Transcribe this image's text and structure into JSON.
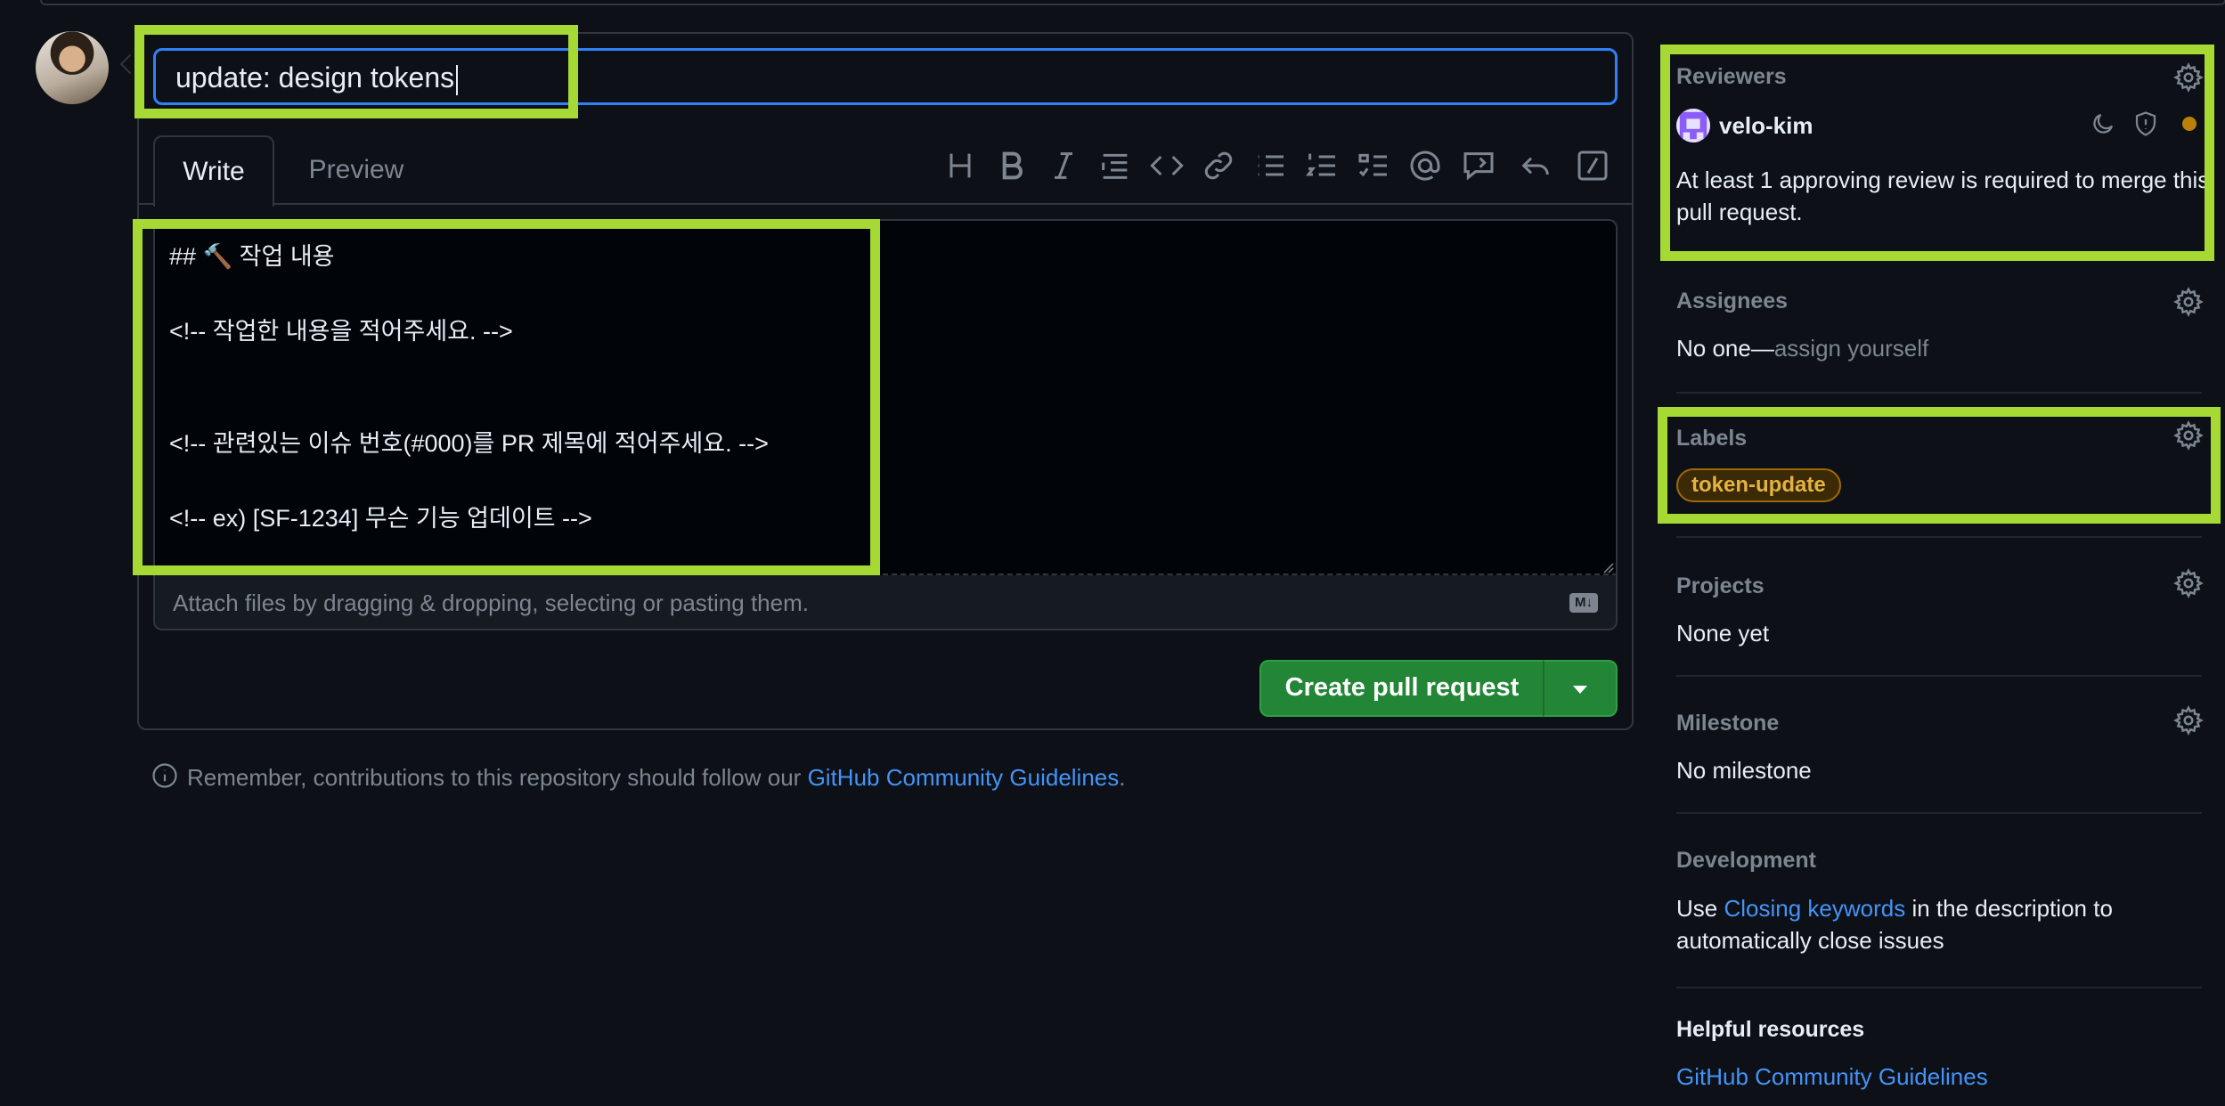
{
  "pr": {
    "title_value": "update: design tokens",
    "tabs": {
      "write": "Write",
      "preview": "Preview"
    },
    "body_lines": [
      "## 🔨 작업 내용",
      "<!-- 작업한 내용을 적어주세요. -->",
      "<!-- 관련있는 이슈 번호(#000)를 PR 제목에 적어주세요. -->",
      "<!-- ex) [SF-1234] 무슨 기능 업데이트 -->"
    ],
    "attach_text": "Attach files by dragging & dropping, selecting or pasting them.",
    "markdown_badge": "M↓",
    "create_label": "Create pull request",
    "remember_prefix": "Remember, contributions to this repository should follow our ",
    "remember_link": "GitHub Community Guidelines",
    "remember_suffix": "."
  },
  "toolbar": [
    "heading-icon",
    "bold-icon",
    "italic-icon",
    "quote-icon",
    "code-icon",
    "link-icon",
    "bullet-list-icon",
    "numbered-list-icon",
    "task-list-icon",
    "mention-icon",
    "reference-icon",
    "reply-icon",
    "slash-command-icon"
  ],
  "sidebar": {
    "reviewers": {
      "heading": "Reviewers",
      "reviewer": "velo-kim",
      "note": "At least 1 approving review is required to merge this pull request."
    },
    "assignees": {
      "heading": "Assignees",
      "none": "No one—",
      "assign_link": "assign yourself"
    },
    "labels": {
      "heading": "Labels",
      "items": [
        "token-update"
      ]
    },
    "projects": {
      "heading": "Projects",
      "value": "None yet"
    },
    "milestone": {
      "heading": "Milestone",
      "value": "No milestone"
    },
    "development": {
      "heading": "Development",
      "prefix": "Use ",
      "link": "Closing keywords",
      "suffix": " in the description to",
      "line2": "automatically close issues"
    },
    "helpful": {
      "heading": "Helpful resources",
      "link": "GitHub Community Guidelines"
    }
  },
  "colors": {
    "accent_highlight": "#a6d934",
    "focus_blue": "#2f81f7",
    "primary_green": "#238636",
    "link_blue": "#4493f8",
    "label_gold": "#e3b341"
  }
}
